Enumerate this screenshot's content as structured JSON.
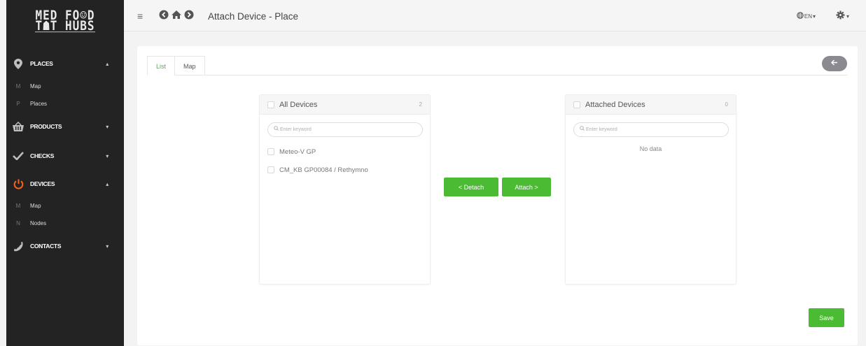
{
  "sidebar": {
    "logo_line1": "MED FO☺D",
    "logo_line2": "T☗T HUBS",
    "sections": [
      {
        "label": "PLACES",
        "icon": "map-pin-icon",
        "caret": "▴"
      },
      {
        "label": "PRODUCTS",
        "icon": "basket-icon",
        "caret": "▾"
      },
      {
        "label": "CHECKS",
        "icon": "checkmark-icon",
        "caret": "▾"
      },
      {
        "label": "DEVICES",
        "icon": "power-icon",
        "caret": "▴",
        "accent": "#f26522"
      },
      {
        "label": "CONTACTS",
        "icon": "phone-icon",
        "caret": "▾"
      }
    ],
    "places_sub": [
      {
        "letter": "M",
        "label": "Map"
      },
      {
        "letter": "P",
        "label": "Places"
      }
    ],
    "devices_sub": [
      {
        "letter": "M",
        "label": "Map"
      },
      {
        "letter": "N",
        "label": "Nodes"
      }
    ]
  },
  "topbar": {
    "title": "Attach Device - Place",
    "lang": "EN",
    "hamburger": "≡"
  },
  "tabs": [
    {
      "label": "List",
      "active": true
    },
    {
      "label": "Map",
      "active": false
    }
  ],
  "left_panel": {
    "title": "All Devices",
    "count": "2",
    "search_placeholder": "Enter keyword",
    "items": [
      "Meteo-V GP",
      "CM_KB GP00084 / Rethymno"
    ]
  },
  "right_panel": {
    "title": "Attached Devices",
    "count": "0",
    "search_placeholder": "Enter keyword",
    "empty": "No data"
  },
  "buttons": {
    "detach": "< Detach",
    "attach": "Attach >",
    "save": "Save"
  },
  "colors": {
    "accent_green": "#4cbb34",
    "sidebar_bg": "#232323",
    "devices_icon": "#f26522"
  }
}
